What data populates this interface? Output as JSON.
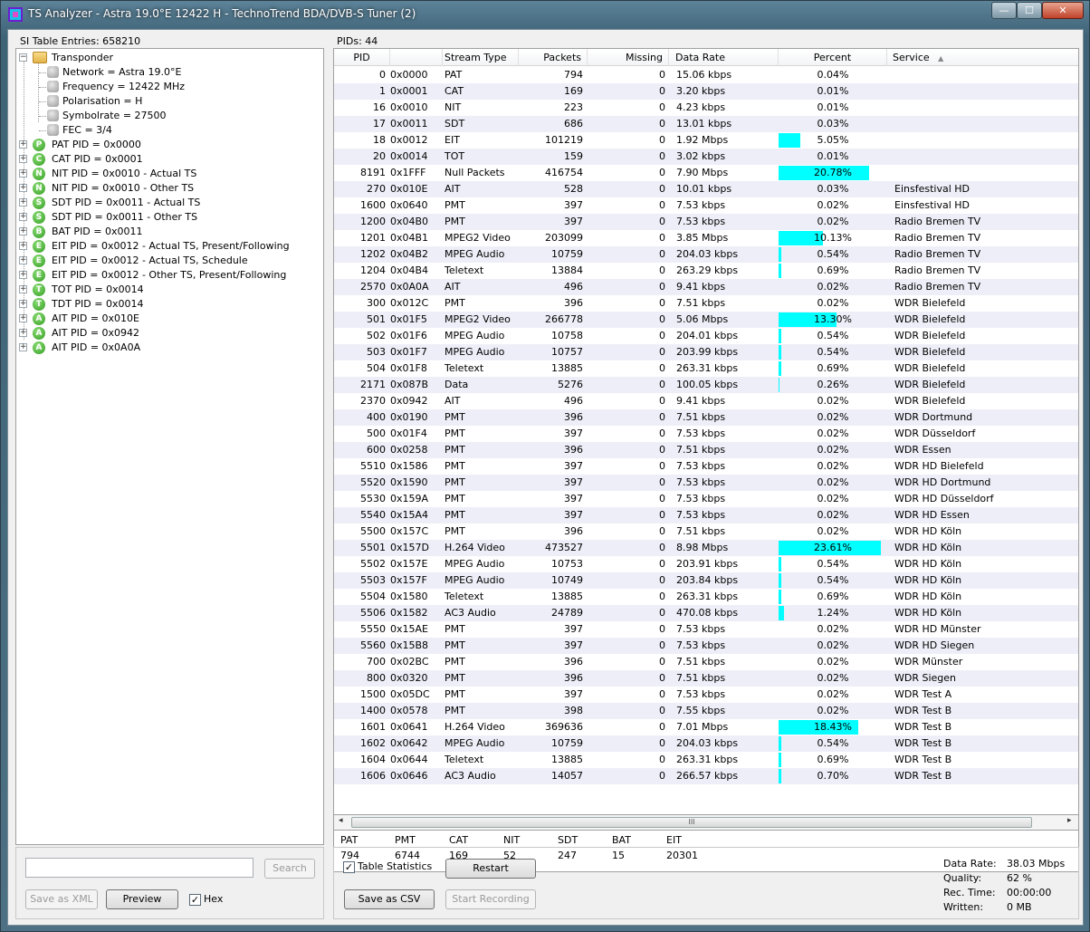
{
  "window": {
    "title": "TS Analyzer - Astra 19.0°E 12422 H - TechnoTrend BDA/DVB-S Tuner (2)",
    "min_glyph": "—",
    "max_glyph": "☐",
    "close_glyph": "✕"
  },
  "left": {
    "si_label": "SI Table Entries: 658210",
    "tree_root": "Transponder",
    "tree_items": [
      {
        "label": "Network = Astra 19.0°E",
        "icon": "",
        "child": true
      },
      {
        "label": "Frequency = 12422 MHz",
        "icon": "",
        "child": true
      },
      {
        "label": "Polarisation = H",
        "icon": "",
        "child": true
      },
      {
        "label": "Symbolrate = 27500",
        "icon": "",
        "child": true
      },
      {
        "label": "FEC = 3/4",
        "icon": "",
        "child": true
      },
      {
        "label": "PAT PID = 0x0000",
        "icon": "P",
        "child": false
      },
      {
        "label": "CAT PID = 0x0001",
        "icon": "C",
        "child": false
      },
      {
        "label": "NIT PID = 0x0010 - Actual TS",
        "icon": "N",
        "child": false
      },
      {
        "label": "NIT PID = 0x0010 - Other TS",
        "icon": "N",
        "child": false
      },
      {
        "label": "SDT PID = 0x0011 - Actual TS",
        "icon": "S",
        "child": false
      },
      {
        "label": "SDT PID = 0x0011 - Other TS",
        "icon": "S",
        "child": false
      },
      {
        "label": "BAT PID = 0x0011",
        "icon": "B",
        "child": false
      },
      {
        "label": "EIT PID = 0x0012 - Actual TS, Present/Following",
        "icon": "E",
        "child": false
      },
      {
        "label": "EIT PID = 0x0012 - Actual TS, Schedule",
        "icon": "E",
        "child": false
      },
      {
        "label": "EIT PID = 0x0012 - Other TS, Present/Following",
        "icon": "E",
        "child": false
      },
      {
        "label": "TOT PID = 0x0014",
        "icon": "T",
        "child": false
      },
      {
        "label": "TDT PID = 0x0014",
        "icon": "T",
        "child": false
      },
      {
        "label": "AIT PID = 0x010E",
        "icon": "A",
        "child": false
      },
      {
        "label": "AIT PID = 0x0942",
        "icon": "A",
        "child": false
      },
      {
        "label": "AIT PID = 0x0A0A",
        "icon": "A",
        "child": false
      }
    ],
    "search_placeholder": "",
    "search_button": "Search",
    "save_xml_button": "Save as XML",
    "preview_button": "Preview",
    "hex_label": "Hex",
    "hex_checked": true
  },
  "right": {
    "pids_label": "PIDs: 44",
    "columns": [
      "PID",
      "Stream Type",
      "Packets",
      "Missing",
      "Data Rate",
      "Percent",
      "Service"
    ],
    "sort_glyph": "▲",
    "rows": [
      [
        "0",
        "0x0000",
        "PAT",
        "794",
        "0",
        "15.06 kbps",
        "0.04%",
        0.04,
        ""
      ],
      [
        "1",
        "0x0001",
        "CAT",
        "169",
        "0",
        "3.20 kbps",
        "0.01%",
        0.01,
        ""
      ],
      [
        "16",
        "0x0010",
        "NIT",
        "223",
        "0",
        "4.23 kbps",
        "0.01%",
        0.01,
        ""
      ],
      [
        "17",
        "0x0011",
        "SDT",
        "686",
        "0",
        "13.01 kbps",
        "0.03%",
        0.03,
        ""
      ],
      [
        "18",
        "0x0012",
        "EIT",
        "101219",
        "0",
        "1.92 Mbps",
        "5.05%",
        5.05,
        ""
      ],
      [
        "20",
        "0x0014",
        "TOT",
        "159",
        "0",
        "3.02 kbps",
        "0.01%",
        0.01,
        ""
      ],
      [
        "8191",
        "0x1FFF",
        "Null Packets",
        "416754",
        "0",
        "7.90 Mbps",
        "20.78%",
        20.78,
        ""
      ],
      [
        "270",
        "0x010E",
        "AIT",
        "528",
        "0",
        "10.01 kbps",
        "0.03%",
        0.03,
        "Einsfestival HD"
      ],
      [
        "1600",
        "0x0640",
        "PMT",
        "397",
        "0",
        "7.53 kbps",
        "0.02%",
        0.02,
        "Einsfestival HD"
      ],
      [
        "1200",
        "0x04B0",
        "PMT",
        "397",
        "0",
        "7.53 kbps",
        "0.02%",
        0.02,
        "Radio Bremen TV"
      ],
      [
        "1201",
        "0x04B1",
        "MPEG2 Video",
        "203099",
        "0",
        "3.85 Mbps",
        "10.13%",
        10.13,
        "Radio Bremen TV"
      ],
      [
        "1202",
        "0x04B2",
        "MPEG Audio",
        "10759",
        "0",
        "204.03 kbps",
        "0.54%",
        0.54,
        "Radio Bremen TV"
      ],
      [
        "1204",
        "0x04B4",
        "Teletext",
        "13884",
        "0",
        "263.29 kbps",
        "0.69%",
        0.69,
        "Radio Bremen TV"
      ],
      [
        "2570",
        "0x0A0A",
        "AIT",
        "496",
        "0",
        "9.41 kbps",
        "0.02%",
        0.02,
        "Radio Bremen TV"
      ],
      [
        "300",
        "0x012C",
        "PMT",
        "396",
        "0",
        "7.51 kbps",
        "0.02%",
        0.02,
        "WDR Bielefeld"
      ],
      [
        "501",
        "0x01F5",
        "MPEG2 Video",
        "266778",
        "0",
        "5.06 Mbps",
        "13.30%",
        13.3,
        "WDR Bielefeld"
      ],
      [
        "502",
        "0x01F6",
        "MPEG Audio",
        "10758",
        "0",
        "204.01 kbps",
        "0.54%",
        0.54,
        "WDR Bielefeld"
      ],
      [
        "503",
        "0x01F7",
        "MPEG Audio",
        "10757",
        "0",
        "203.99 kbps",
        "0.54%",
        0.54,
        "WDR Bielefeld"
      ],
      [
        "504",
        "0x01F8",
        "Teletext",
        "13885",
        "0",
        "263.31 kbps",
        "0.69%",
        0.69,
        "WDR Bielefeld"
      ],
      [
        "2171",
        "0x087B",
        "Data",
        "5276",
        "0",
        "100.05 kbps",
        "0.26%",
        0.26,
        "WDR Bielefeld"
      ],
      [
        "2370",
        "0x0942",
        "AIT",
        "496",
        "0",
        "9.41 kbps",
        "0.02%",
        0.02,
        "WDR Bielefeld"
      ],
      [
        "400",
        "0x0190",
        "PMT",
        "396",
        "0",
        "7.51 kbps",
        "0.02%",
        0.02,
        "WDR Dortmund"
      ],
      [
        "500",
        "0x01F4",
        "PMT",
        "397",
        "0",
        "7.53 kbps",
        "0.02%",
        0.02,
        "WDR Düsseldorf"
      ],
      [
        "600",
        "0x0258",
        "PMT",
        "396",
        "0",
        "7.51 kbps",
        "0.02%",
        0.02,
        "WDR Essen"
      ],
      [
        "5510",
        "0x1586",
        "PMT",
        "397",
        "0",
        "7.53 kbps",
        "0.02%",
        0.02,
        "WDR HD Bielefeld"
      ],
      [
        "5520",
        "0x1590",
        "PMT",
        "397",
        "0",
        "7.53 kbps",
        "0.02%",
        0.02,
        "WDR HD Dortmund"
      ],
      [
        "5530",
        "0x159A",
        "PMT",
        "397",
        "0",
        "7.53 kbps",
        "0.02%",
        0.02,
        "WDR HD Düsseldorf"
      ],
      [
        "5540",
        "0x15A4",
        "PMT",
        "397",
        "0",
        "7.53 kbps",
        "0.02%",
        0.02,
        "WDR HD Essen"
      ],
      [
        "5500",
        "0x157C",
        "PMT",
        "396",
        "0",
        "7.51 kbps",
        "0.02%",
        0.02,
        "WDR HD Köln"
      ],
      [
        "5501",
        "0x157D",
        "H.264 Video",
        "473527",
        "0",
        "8.98 Mbps",
        "23.61%",
        23.61,
        "WDR HD Köln"
      ],
      [
        "5502",
        "0x157E",
        "MPEG Audio",
        "10753",
        "0",
        "203.91 kbps",
        "0.54%",
        0.54,
        "WDR HD Köln"
      ],
      [
        "5503",
        "0x157F",
        "MPEG Audio",
        "10749",
        "0",
        "203.84 kbps",
        "0.54%",
        0.54,
        "WDR HD Köln"
      ],
      [
        "5504",
        "0x1580",
        "Teletext",
        "13885",
        "0",
        "263.31 kbps",
        "0.69%",
        0.69,
        "WDR HD Köln"
      ],
      [
        "5506",
        "0x1582",
        "AC3 Audio",
        "24789",
        "0",
        "470.08 kbps",
        "1.24%",
        1.24,
        "WDR HD Köln"
      ],
      [
        "5550",
        "0x15AE",
        "PMT",
        "397",
        "0",
        "7.53 kbps",
        "0.02%",
        0.02,
        "WDR HD Münster"
      ],
      [
        "5560",
        "0x15B8",
        "PMT",
        "397",
        "0",
        "7.53 kbps",
        "0.02%",
        0.02,
        "WDR HD Siegen"
      ],
      [
        "700",
        "0x02BC",
        "PMT",
        "396",
        "0",
        "7.51 kbps",
        "0.02%",
        0.02,
        "WDR Münster"
      ],
      [
        "800",
        "0x0320",
        "PMT",
        "396",
        "0",
        "7.51 kbps",
        "0.02%",
        0.02,
        "WDR Siegen"
      ],
      [
        "1500",
        "0x05DC",
        "PMT",
        "397",
        "0",
        "7.53 kbps",
        "0.02%",
        0.02,
        "WDR Test A"
      ],
      [
        "1400",
        "0x0578",
        "PMT",
        "398",
        "0",
        "7.55 kbps",
        "0.02%",
        0.02,
        "WDR Test B"
      ],
      [
        "1601",
        "0x0641",
        "H.264 Video",
        "369636",
        "0",
        "7.01 Mbps",
        "18.43%",
        18.43,
        "WDR Test B"
      ],
      [
        "1602",
        "0x0642",
        "MPEG Audio",
        "10759",
        "0",
        "204.03 kbps",
        "0.54%",
        0.54,
        "WDR Test B"
      ],
      [
        "1604",
        "0x0644",
        "Teletext",
        "13885",
        "0",
        "263.31 kbps",
        "0.69%",
        0.69,
        "WDR Test B"
      ],
      [
        "1606",
        "0x0646",
        "AC3 Audio",
        "14057",
        "0",
        "266.57 kbps",
        "0.70%",
        0.7,
        "WDR Test B"
      ]
    ],
    "scroll_grip": "III",
    "table_stats": [
      {
        "name": "PAT",
        "value": "794"
      },
      {
        "name": "PMT",
        "value": "6744"
      },
      {
        "name": "CAT",
        "value": "169"
      },
      {
        "name": "NIT",
        "value": "52"
      },
      {
        "name": "SDT",
        "value": "247"
      },
      {
        "name": "BAT",
        "value": "15"
      },
      {
        "name": "EIT",
        "value": "20301"
      }
    ],
    "table_statistics_label": "Table Statistics",
    "table_statistics_checked": true,
    "restart_button": "Restart",
    "save_csv_button": "Save as CSV",
    "start_recording_button": "Start Recording",
    "info": [
      {
        "label": "Data Rate:",
        "value": "38.03 Mbps"
      },
      {
        "label": "Quality:",
        "value": "62 %"
      },
      {
        "label": "Rec. Time:",
        "value": "00:00:00"
      },
      {
        "label": "Written:",
        "value": "0 MB"
      }
    ]
  }
}
